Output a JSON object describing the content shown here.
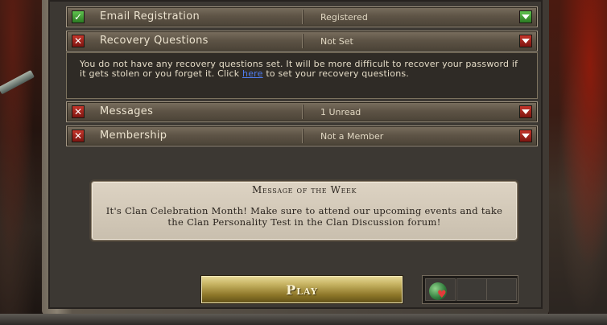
{
  "account_rows": [
    {
      "label": "Email Registration",
      "value": "Registered",
      "status": "ok"
    },
    {
      "label": "Recovery Questions",
      "value": "Not Set",
      "status": "bad"
    },
    {
      "label": "Messages",
      "value": "1 Unread",
      "status": "bad"
    },
    {
      "label": "Membership",
      "value": "Not a Member",
      "status": "bad"
    }
  ],
  "recovery_panel": {
    "text_before": "You do not have any recovery questions set. It will be more difficult to recover your password if it gets stolen or you forget it. Click ",
    "link": "here",
    "text_after": " to set your recovery questions."
  },
  "motw": {
    "title": "Message of the Week",
    "body": "It's Clan Celebration Month! Make sure to attend our upcoming events and take the Clan Personality Test in the Clan Discussion forum!"
  },
  "play_label": "Play",
  "icons": {
    "ok": "check-icon",
    "bad": "cross-icon",
    "toggle": "triangle-down-icon",
    "world": "globe-heart-icon"
  },
  "colors": {
    "ok": "#3a9a2e",
    "bad": "#a3221a",
    "link": "#4f7df0",
    "play_gold": "#c7b463"
  }
}
